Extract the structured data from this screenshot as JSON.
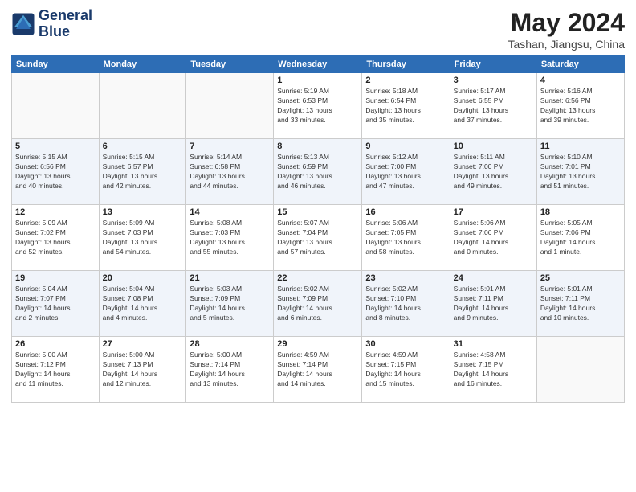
{
  "header": {
    "logo_line1": "General",
    "logo_line2": "Blue",
    "month_title": "May 2024",
    "location": "Tashan, Jiangsu, China"
  },
  "weekdays": [
    "Sunday",
    "Monday",
    "Tuesday",
    "Wednesday",
    "Thursday",
    "Friday",
    "Saturday"
  ],
  "weeks": [
    [
      {
        "day": "",
        "info": ""
      },
      {
        "day": "",
        "info": ""
      },
      {
        "day": "",
        "info": ""
      },
      {
        "day": "1",
        "info": "Sunrise: 5:19 AM\nSunset: 6:53 PM\nDaylight: 13 hours\nand 33 minutes."
      },
      {
        "day": "2",
        "info": "Sunrise: 5:18 AM\nSunset: 6:54 PM\nDaylight: 13 hours\nand 35 minutes."
      },
      {
        "day": "3",
        "info": "Sunrise: 5:17 AM\nSunset: 6:55 PM\nDaylight: 13 hours\nand 37 minutes."
      },
      {
        "day": "4",
        "info": "Sunrise: 5:16 AM\nSunset: 6:56 PM\nDaylight: 13 hours\nand 39 minutes."
      }
    ],
    [
      {
        "day": "5",
        "info": "Sunrise: 5:15 AM\nSunset: 6:56 PM\nDaylight: 13 hours\nand 40 minutes."
      },
      {
        "day": "6",
        "info": "Sunrise: 5:15 AM\nSunset: 6:57 PM\nDaylight: 13 hours\nand 42 minutes."
      },
      {
        "day": "7",
        "info": "Sunrise: 5:14 AM\nSunset: 6:58 PM\nDaylight: 13 hours\nand 44 minutes."
      },
      {
        "day": "8",
        "info": "Sunrise: 5:13 AM\nSunset: 6:59 PM\nDaylight: 13 hours\nand 46 minutes."
      },
      {
        "day": "9",
        "info": "Sunrise: 5:12 AM\nSunset: 7:00 PM\nDaylight: 13 hours\nand 47 minutes."
      },
      {
        "day": "10",
        "info": "Sunrise: 5:11 AM\nSunset: 7:00 PM\nDaylight: 13 hours\nand 49 minutes."
      },
      {
        "day": "11",
        "info": "Sunrise: 5:10 AM\nSunset: 7:01 PM\nDaylight: 13 hours\nand 51 minutes."
      }
    ],
    [
      {
        "day": "12",
        "info": "Sunrise: 5:09 AM\nSunset: 7:02 PM\nDaylight: 13 hours\nand 52 minutes."
      },
      {
        "day": "13",
        "info": "Sunrise: 5:09 AM\nSunset: 7:03 PM\nDaylight: 13 hours\nand 54 minutes."
      },
      {
        "day": "14",
        "info": "Sunrise: 5:08 AM\nSunset: 7:03 PM\nDaylight: 13 hours\nand 55 minutes."
      },
      {
        "day": "15",
        "info": "Sunrise: 5:07 AM\nSunset: 7:04 PM\nDaylight: 13 hours\nand 57 minutes."
      },
      {
        "day": "16",
        "info": "Sunrise: 5:06 AM\nSunset: 7:05 PM\nDaylight: 13 hours\nand 58 minutes."
      },
      {
        "day": "17",
        "info": "Sunrise: 5:06 AM\nSunset: 7:06 PM\nDaylight: 14 hours\nand 0 minutes."
      },
      {
        "day": "18",
        "info": "Sunrise: 5:05 AM\nSunset: 7:06 PM\nDaylight: 14 hours\nand 1 minute."
      }
    ],
    [
      {
        "day": "19",
        "info": "Sunrise: 5:04 AM\nSunset: 7:07 PM\nDaylight: 14 hours\nand 2 minutes."
      },
      {
        "day": "20",
        "info": "Sunrise: 5:04 AM\nSunset: 7:08 PM\nDaylight: 14 hours\nand 4 minutes."
      },
      {
        "day": "21",
        "info": "Sunrise: 5:03 AM\nSunset: 7:09 PM\nDaylight: 14 hours\nand 5 minutes."
      },
      {
        "day": "22",
        "info": "Sunrise: 5:02 AM\nSunset: 7:09 PM\nDaylight: 14 hours\nand 6 minutes."
      },
      {
        "day": "23",
        "info": "Sunrise: 5:02 AM\nSunset: 7:10 PM\nDaylight: 14 hours\nand 8 minutes."
      },
      {
        "day": "24",
        "info": "Sunrise: 5:01 AM\nSunset: 7:11 PM\nDaylight: 14 hours\nand 9 minutes."
      },
      {
        "day": "25",
        "info": "Sunrise: 5:01 AM\nSunset: 7:11 PM\nDaylight: 14 hours\nand 10 minutes."
      }
    ],
    [
      {
        "day": "26",
        "info": "Sunrise: 5:00 AM\nSunset: 7:12 PM\nDaylight: 14 hours\nand 11 minutes."
      },
      {
        "day": "27",
        "info": "Sunrise: 5:00 AM\nSunset: 7:13 PM\nDaylight: 14 hours\nand 12 minutes."
      },
      {
        "day": "28",
        "info": "Sunrise: 5:00 AM\nSunset: 7:14 PM\nDaylight: 14 hours\nand 13 minutes."
      },
      {
        "day": "29",
        "info": "Sunrise: 4:59 AM\nSunset: 7:14 PM\nDaylight: 14 hours\nand 14 minutes."
      },
      {
        "day": "30",
        "info": "Sunrise: 4:59 AM\nSunset: 7:15 PM\nDaylight: 14 hours\nand 15 minutes."
      },
      {
        "day": "31",
        "info": "Sunrise: 4:58 AM\nSunset: 7:15 PM\nDaylight: 14 hours\nand 16 minutes."
      },
      {
        "day": "",
        "info": ""
      }
    ]
  ]
}
